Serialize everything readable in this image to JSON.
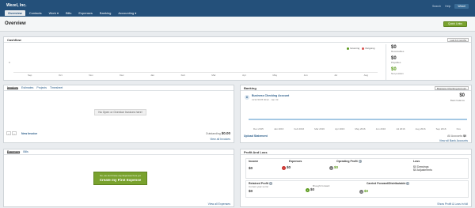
{
  "app": {
    "company": "Wezel, Inc.",
    "top_links": [
      "Search",
      "Help"
    ],
    "user_button": "Wezel"
  },
  "nav": {
    "items": [
      "Overview",
      "Contacts",
      "Work ▾",
      "Bills",
      "Expenses",
      "Banking",
      "Accounting ▾"
    ]
  },
  "page": {
    "title": "Overview",
    "quick_links": "Quick Links"
  },
  "cashflow": {
    "title": "Cashflow",
    "select": "Last 12 months",
    "legend": [
      {
        "label": "Incoming",
        "color": "#5a9a1a"
      },
      {
        "label": "Outgoing",
        "color": "#d9534f"
      }
    ],
    "y_tick": "0",
    "months": [
      "Sep",
      "Oct",
      "Nov",
      "Dec",
      "Jan",
      "Feb",
      "Mar",
      "Apr",
      "May",
      "Jun",
      "Jul",
      "Aug"
    ],
    "stats": [
      {
        "value": "$0",
        "label": "Receivables"
      },
      {
        "value": "$0",
        "label": "Payables"
      },
      {
        "value": "$0",
        "label": "Net position"
      }
    ]
  },
  "invoices": {
    "tabs": [
      "Invoices",
      "Estimates",
      "Projects",
      "Timesheet"
    ],
    "empty": "No Open or Overdue Invoices here!",
    "new_invoice": "New Invoice",
    "outstanding_label": "Outstanding",
    "outstanding_value": "$0.00",
    "view_all": "View all Invoices"
  },
  "banking": {
    "title": "Banking",
    "select": "Business Checking Account",
    "account_name": "Business Checking Account",
    "account_sub": "1234 5678 9012 · Jan 03",
    "balance": "$0",
    "balance_label": "Bank balance",
    "months": [
      "Dec 2015",
      "Jan 2016",
      "Feb 2016",
      "Mar 2016",
      "Apr 2016",
      "May 2016",
      "Jun 2016",
      "Jul 2016",
      "Aug 2016",
      "Sep 2016",
      "Nov"
    ],
    "upload": "Upload Statement",
    "all_accounts_label": "All Accounts",
    "all_accounts_value": "$0",
    "view_all": "View all Bank Accounts"
  },
  "expenses": {
    "tabs": [
      "Expenses",
      "Bills"
    ],
    "hint": "No, we don't have any Expenses here yet",
    "create": "Create my First Expense",
    "view_all": "View all Expenses"
  },
  "pl": {
    "title": "Profit And Loss",
    "income_label": "Income",
    "income_value": "$0",
    "expenses_label": "Expenses",
    "expenses_value": "$0",
    "op_label": "Operating Profit",
    "op_value": "$0",
    "loss_label": "Loss",
    "loss_lines": [
      "$0 Drawings",
      "$0 Adjustments"
    ],
    "retained_label": "Retained Profit",
    "retained_sub": "Current year so far",
    "retained_value": "$0",
    "brought_label": "Brought forward",
    "brought_value": "$0",
    "carried_label": "Carried Forward/Distributable",
    "carried_value": "$0",
    "view_all": "Show Profit & Loss in full"
  }
}
